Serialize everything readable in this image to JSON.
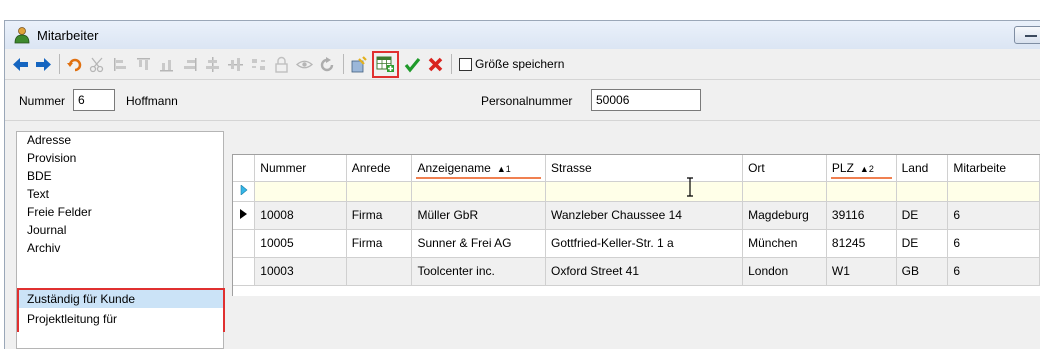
{
  "window": {
    "title": "Mitarbeiter"
  },
  "toolbar": {
    "icons": [
      "arrow-left-icon",
      "arrow-right-icon",
      "undo-icon",
      "cut-icon",
      "align-icons",
      "lock-icon",
      "eye-icon",
      "refresh-icon",
      "wizard-icon",
      "add-row-icon",
      "check-icon",
      "cancel-icon"
    ],
    "save_size_label": "Größe speichern"
  },
  "header": {
    "nummer_label": "Nummer",
    "nummer_value": "6",
    "name_value": "Hoffmann",
    "personalnummer_label": "Personalnummer",
    "personalnummer_value": "50006"
  },
  "sidebar": {
    "items": [
      {
        "label": "Adresse"
      },
      {
        "label": "Provision"
      },
      {
        "label": "BDE"
      },
      {
        "label": "Text"
      },
      {
        "label": "Freie Felder"
      },
      {
        "label": "Journal"
      },
      {
        "label": "Archiv"
      },
      {
        "label": "Zuständig für Kunde"
      },
      {
        "label": "Projektleitung für"
      }
    ],
    "selected": "Zuständig für Kunde"
  },
  "grid": {
    "columns": [
      {
        "label": "Nummer"
      },
      {
        "label": "Anrede"
      },
      {
        "label": "Anzeigename",
        "sort": "▲1"
      },
      {
        "label": "Strasse"
      },
      {
        "label": "Ort"
      },
      {
        "label": "PLZ",
        "sort": "▲2"
      },
      {
        "label": "Land"
      },
      {
        "label": "Mitarbeite"
      }
    ],
    "rows": [
      {
        "nummer": "10008",
        "anrede": "Firma",
        "anzeigename": "Müller GbR",
        "strasse": "Wanzleber Chaussee 14",
        "ort": "Magdeburg",
        "plz": "39116",
        "land": "DE",
        "mitarbeiter": "6"
      },
      {
        "nummer": "10005",
        "anrede": "Firma",
        "anzeigename": "Sunner & Frei AG",
        "strasse": "Gottfried-Keller-Str. 1 a",
        "ort": "München",
        "plz": "81245",
        "land": "DE",
        "mitarbeiter": "6"
      },
      {
        "nummer": "10003",
        "anrede": "",
        "anzeigename": "Toolcenter inc.",
        "strasse": "Oxford Street 41",
        "ort": "London",
        "plz": "W1",
        "land": "GB",
        "mitarbeiter": "6"
      }
    ]
  },
  "colors": {
    "highlight": "#e03030",
    "sort_underline": "#f08050",
    "filter_row": "#ffffe8",
    "selected_nav": "#cbe3f7"
  }
}
